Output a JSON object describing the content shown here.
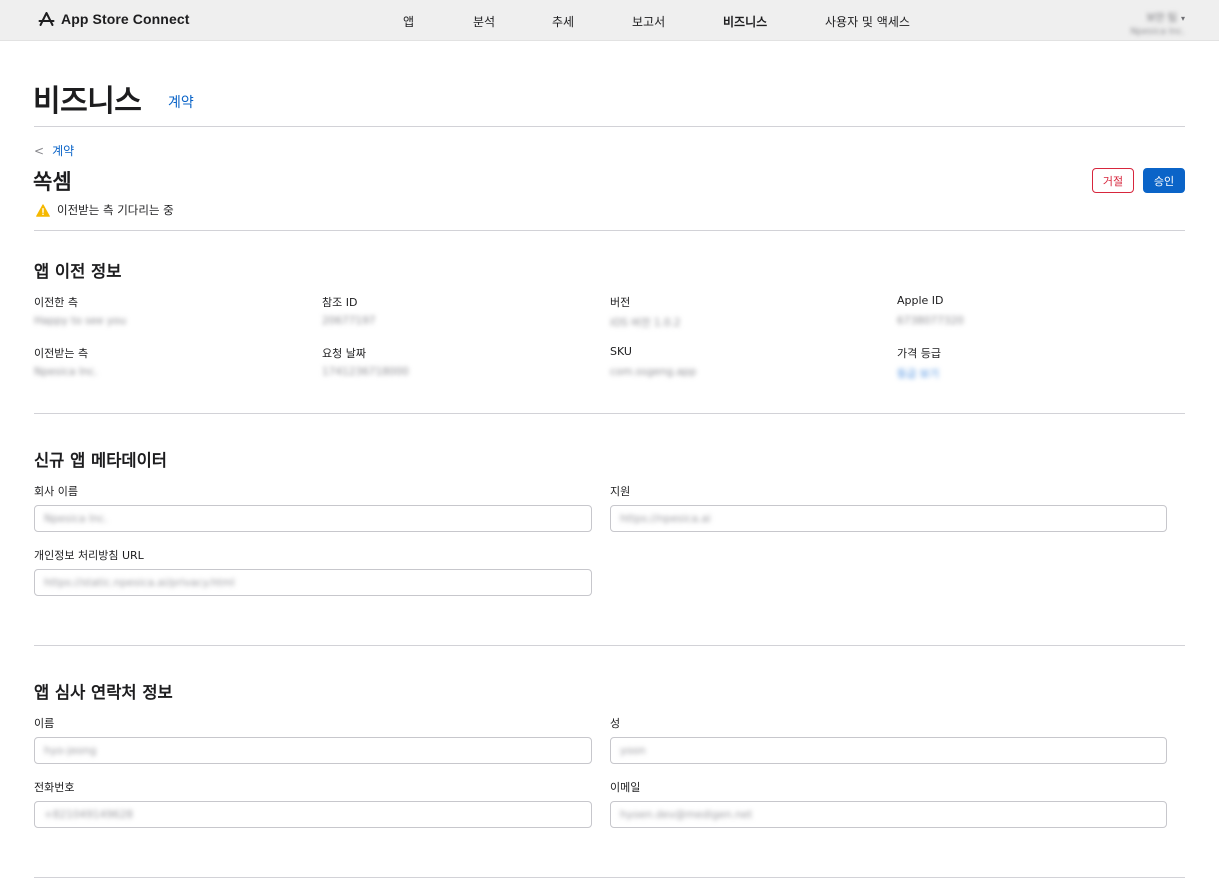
{
  "header": {
    "brand": "App Store Connect",
    "nav": [
      "앱",
      "분석",
      "추세",
      "보고서",
      "비즈니스",
      "사용자 및 액세스"
    ],
    "active_nav": "비즈니스",
    "account_name": "보안 팀",
    "account_org": "Npesica Inc."
  },
  "page": {
    "title": "비즈니스",
    "tab": "계약"
  },
  "detail": {
    "back_label": "계약",
    "app_name": "쏙셈",
    "status": "이전받는 측 기다리는 중",
    "reject_label": "거절",
    "approve_label": "승인"
  },
  "transfer_info": {
    "title": "앱 이전 정보",
    "fields": [
      {
        "label": "이전한 측",
        "value": "Happy to see you"
      },
      {
        "label": "참조 ID",
        "value": "20677197"
      },
      {
        "label": "버전",
        "value": "iOS 버전 1.0.2"
      },
      {
        "label": "Apple ID",
        "value": "6738077320"
      },
      {
        "label": "이전받는 측",
        "value": "Npesica Inc."
      },
      {
        "label": "요청 날짜",
        "value": "1741236718000"
      },
      {
        "label": "SKU",
        "value": "com.ssgeng.app"
      },
      {
        "label": "가격 등급",
        "value": "등급 보기"
      }
    ]
  },
  "metadata": {
    "title": "신규 앱 메타데이터",
    "company_label": "회사 이름",
    "company_value": "Npesica Inc.",
    "support_label": "지원",
    "support_value": "https://npesica.ai",
    "privacy_label": "개인정보 처리방침 URL",
    "privacy_value": "https://static.npesica.ai/privacy.html"
  },
  "review_contact": {
    "title": "앱 심사 연락처 정보",
    "first_name_label": "이름",
    "first_name_value": "hyo-jeong",
    "last_name_label": "성",
    "last_name_value": "yoon",
    "phone_label": "전화번호",
    "phone_value": "+821049149628",
    "email_label": "이메일",
    "email_value": "hyoen.dev@medigen.net"
  },
  "colors": {
    "accent": "#0b64c8",
    "reject": "#d7263d",
    "warning": "#f5b800",
    "topbar": "#efefef"
  }
}
